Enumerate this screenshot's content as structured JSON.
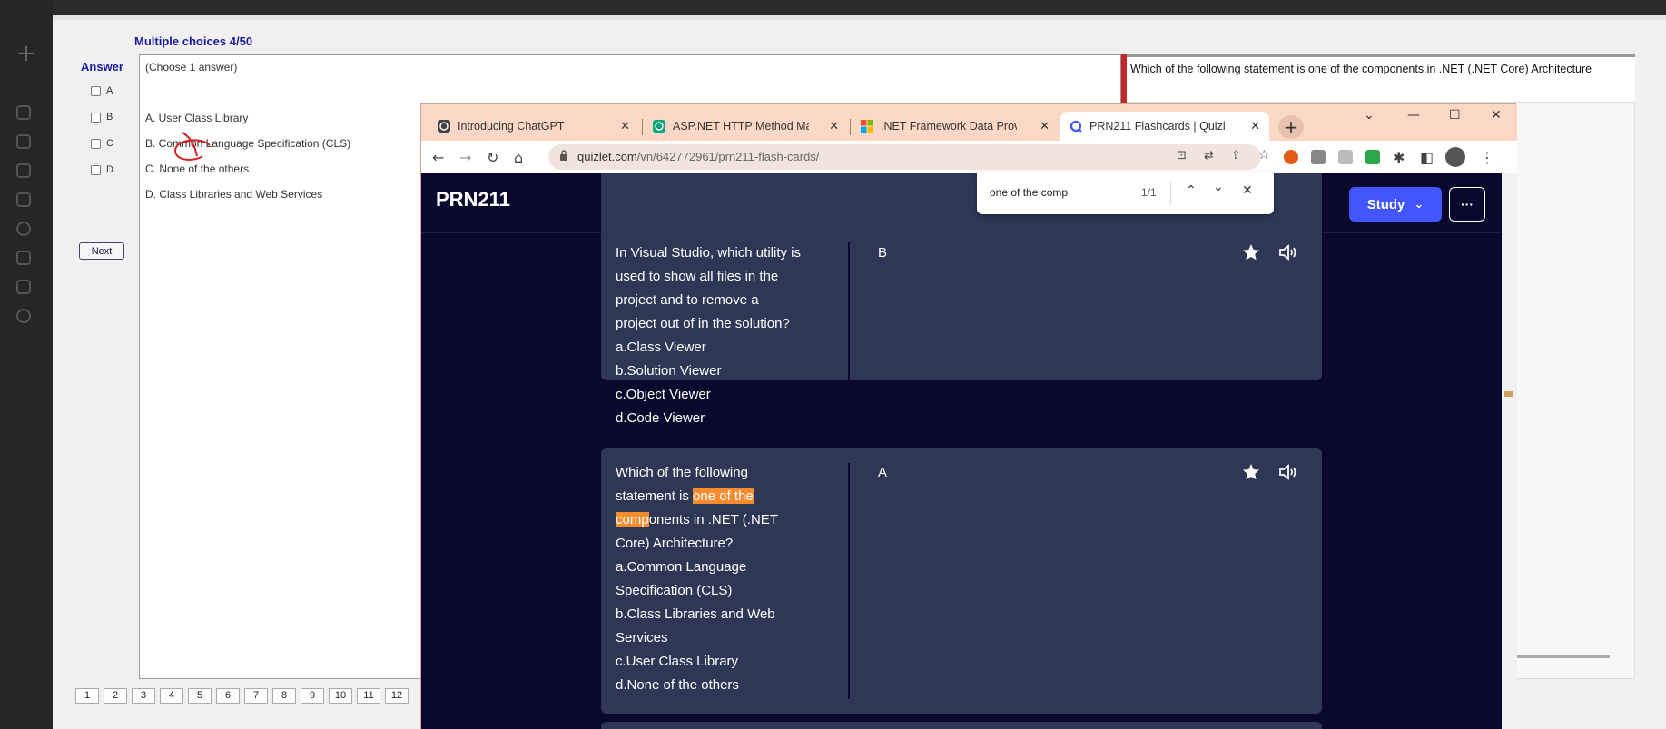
{
  "exam": {
    "title": "Multiple choices 4/50",
    "answer_label": "Answer",
    "checkbox_labels": [
      "A",
      "B",
      "C",
      "D"
    ],
    "choose_text": "(Choose 1 answer)",
    "answers": [
      "A.  User Class Library",
      "B.  Common Language Specification (CLS)",
      "C.  None of the others",
      "D.  Class Libraries and Web Services"
    ],
    "next_label": "Next",
    "question_text": "Which of the following statement is one of the components in  .NET (.NET Core) Architecture",
    "page_numbers": [
      "1",
      "2",
      "3",
      "4",
      "5",
      "6",
      "7",
      "8",
      "9",
      "10",
      "11",
      "12"
    ]
  },
  "browser": {
    "tabs": [
      {
        "title": "Introducing ChatGPT",
        "icon": "chatgpt-icon"
      },
      {
        "title": "ASP.NET HTTP Method Mapping",
        "icon": "chatgpt-icon"
      },
      {
        "title": ".NET Framework Data Providers",
        "icon": "microsoft-icon"
      },
      {
        "title": "PRN211 Flashcards | Quizlet",
        "icon": "quizlet-icon"
      }
    ],
    "url_host": "quizlet.com",
    "url_path": "/vn/642772961/prn211-flash-cards/",
    "find": {
      "query": "one of the comp",
      "count": "1/1"
    }
  },
  "quizlet": {
    "brand": "PRN211",
    "study_label": "Study",
    "more_label": "···",
    "cards": [
      {
        "term_lines": [
          "In Visual Studio, which utility is",
          "used to show all files in the",
          "project and to remove a",
          "project out of in the solution?",
          "a.Class Viewer",
          "b.Solution Viewer",
          "c.Object Viewer",
          "d.Code Viewer"
        ],
        "definition": "B"
      },
      {
        "term_parts": [
          "Which of the following",
          "statement is ",
          "one of the",
          "comp",
          "onents in .NET (.NET",
          "Core) Architecture?",
          "a.Common Language",
          "Specification (CLS)",
          "b.Class Libraries and Web",
          "Services",
          "c.User Class Library",
          "d.None of the others"
        ],
        "definition": "A"
      }
    ]
  }
}
